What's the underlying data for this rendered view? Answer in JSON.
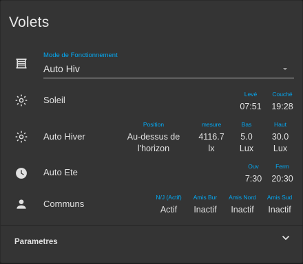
{
  "card": {
    "title": "Volets"
  },
  "mode": {
    "icon": "shutter-icon",
    "label": "Mode de Fonctionnement",
    "value": "Auto Hiv"
  },
  "soleil": {
    "icon": "sun-icon",
    "label": "Soleil",
    "attrs": [
      {
        "name": "Levé",
        "value": "07:51"
      },
      {
        "name": "Couché",
        "value": "19:28"
      }
    ]
  },
  "auto_hiver": {
    "icon": "sun-icon",
    "label": "Auto Hiver",
    "attrs": [
      {
        "name": "Position",
        "value_line1": "Au-dessus de",
        "value_line2": "l'horizon"
      },
      {
        "name": "mesure",
        "value_line1": "4116.7",
        "value_line2": "lx"
      },
      {
        "name": "Bas",
        "value_line1": "5.0",
        "value_line2": "Lux"
      },
      {
        "name": "Haut",
        "value_line1": "30.0",
        "value_line2": "Lux"
      }
    ]
  },
  "auto_ete": {
    "icon": "clock-icon",
    "label": "Auto Ete",
    "attrs": [
      {
        "name": "Ouv",
        "value": "7:30"
      },
      {
        "name": "Ferm",
        "value": "20:30"
      }
    ]
  },
  "communs": {
    "icon": "user-icon",
    "label": "Communs",
    "attrs": [
      {
        "name": "N/J (Actif)",
        "value": "Actif"
      },
      {
        "name": "Amis Bur",
        "value": "Inactif"
      },
      {
        "name": "Amis Nord",
        "value": "Inactif"
      },
      {
        "name": "Amis Sud",
        "value": "Inactif"
      }
    ]
  },
  "parametres": {
    "label": "Parametres",
    "icon": "chevron-down-icon"
  },
  "colors": {
    "accent": "#03a9f4",
    "card": "#343434",
    "text": "#e1e1e1",
    "icon": "#e1e1e1"
  }
}
